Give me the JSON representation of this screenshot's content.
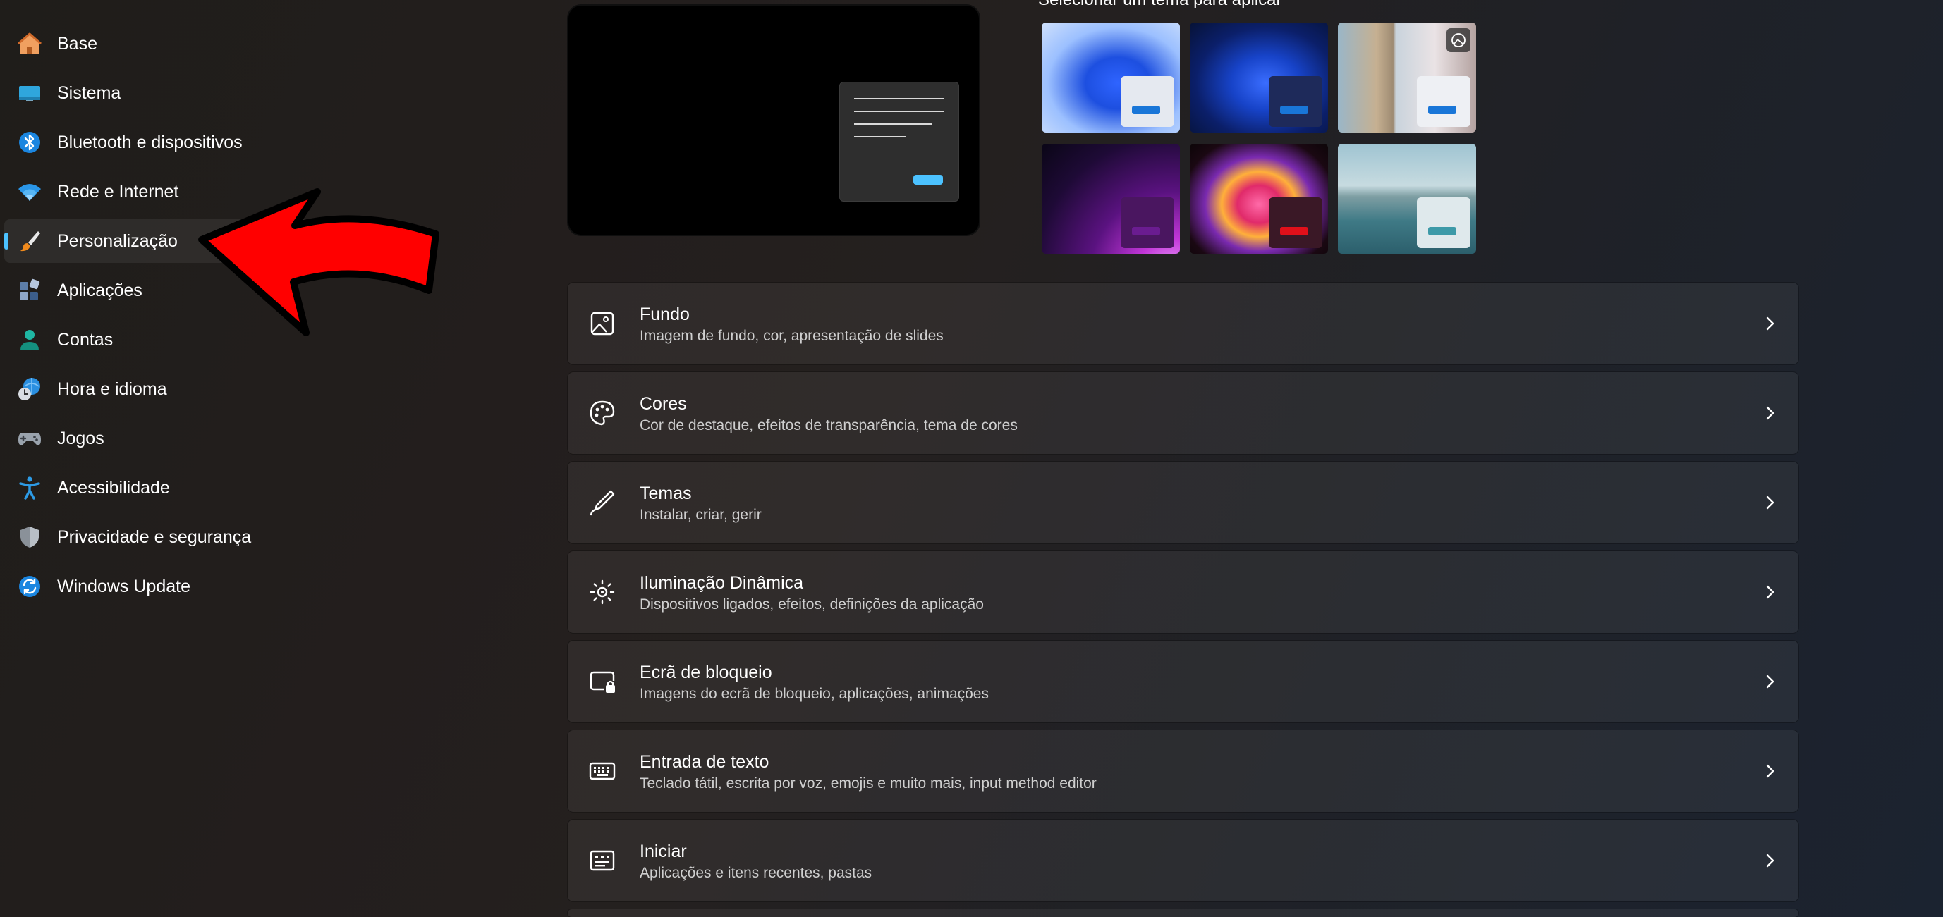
{
  "sidebar": {
    "items": [
      {
        "label": "Base",
        "icon": "home-icon"
      },
      {
        "label": "Sistema",
        "icon": "monitor-icon"
      },
      {
        "label": "Bluetooth e dispositivos",
        "icon": "bluetooth-icon"
      },
      {
        "label": "Rede e Internet",
        "icon": "wifi-icon"
      },
      {
        "label": "Personalização",
        "icon": "brush-icon",
        "selected": true
      },
      {
        "label": "Aplicações",
        "icon": "apps-icon"
      },
      {
        "label": "Contas",
        "icon": "person-icon"
      },
      {
        "label": "Hora e idioma",
        "icon": "clock-globe-icon"
      },
      {
        "label": "Jogos",
        "icon": "gamepad-icon"
      },
      {
        "label": "Acessibilidade",
        "icon": "accessibility-icon"
      },
      {
        "label": "Privacidade e segurança",
        "icon": "shield-icon"
      },
      {
        "label": "Windows Update",
        "icon": "sync-icon"
      }
    ]
  },
  "colors": {
    "accent": "#4cc2ff",
    "annotation_arrow": "#ff0000",
    "tile_accent_blue": "#1976d8",
    "tile_accent_red": "#e0101a",
    "tile_accent_teal": "#3d9aa8"
  },
  "themes": {
    "caption": "Selecionar um tema para aplicar",
    "tiles": [
      {
        "name": "windows-light",
        "icon": "bloom-light"
      },
      {
        "name": "windows-dark",
        "icon": "bloom-dark"
      },
      {
        "name": "flower",
        "icon": "camera-badge-icon"
      },
      {
        "name": "glow",
        "icon": "glow"
      },
      {
        "name": "captured-motion",
        "icon": "captured-motion"
      },
      {
        "name": "sunrise-lake",
        "icon": "lake"
      }
    ]
  },
  "settings": [
    {
      "title": "Fundo",
      "subtitle": "Imagem de fundo, cor, apresentação de slides",
      "icon": "image-icon"
    },
    {
      "title": "Cores",
      "subtitle": "Cor de destaque, efeitos de transparência, tema de cores",
      "icon": "palette-icon"
    },
    {
      "title": "Temas",
      "subtitle": "Instalar, criar, gerir",
      "icon": "pen-icon"
    },
    {
      "title": "Iluminação Dinâmica",
      "subtitle": "Dispositivos ligados, efeitos, definições da aplicação",
      "icon": "sun-icon"
    },
    {
      "title": "Ecrã de bloqueio",
      "subtitle": "Imagens do ecrã de bloqueio, aplicações, animações",
      "icon": "lock-screen-icon"
    },
    {
      "title": "Entrada de texto",
      "subtitle": "Teclado tátil, escrita por voz, emojis e muito mais, input method editor",
      "icon": "keyboard-icon"
    },
    {
      "title": "Iniciar",
      "subtitle": "Aplicações e itens recentes, pastas",
      "icon": "start-icon"
    }
  ]
}
